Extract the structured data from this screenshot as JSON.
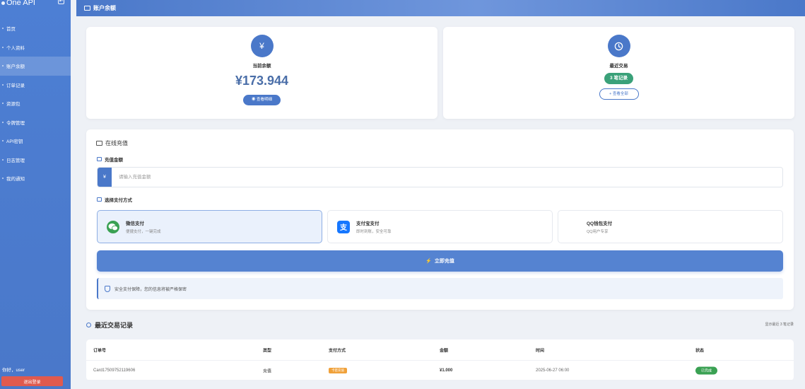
{
  "brand": {
    "name": "One API"
  },
  "sidebar": {
    "items": [
      {
        "label": "首页",
        "active": false
      },
      {
        "label": "个人资料",
        "active": false
      },
      {
        "label": "账户余额",
        "active": true
      },
      {
        "label": "订单记录",
        "active": false
      },
      {
        "label": "资源包",
        "active": false
      },
      {
        "label": "令牌管理",
        "active": false
      },
      {
        "label": "API密钥",
        "active": false
      },
      {
        "label": "日志管理",
        "active": false
      },
      {
        "label": "我的通知",
        "active": false
      }
    ],
    "greeting": "你好，user",
    "logout_label": "退出登录"
  },
  "header": {
    "title": "账户余额"
  },
  "balance": {
    "label": "当前余额",
    "value": "¥173.944",
    "button": "查看明细"
  },
  "recent": {
    "label": "最近交易",
    "count_badge": "3 笔记录",
    "button": "+ 查看全部"
  },
  "recharge": {
    "title": "在线充值",
    "amount_label": "充值金额",
    "currency_prefix": "¥",
    "amount_placeholder": "请输入充值金额",
    "method_label": "选择支付方式",
    "methods": [
      {
        "name": "微信支付",
        "desc": "便捷支付，一键完成",
        "selected": true,
        "icon": "wechat-icon"
      },
      {
        "name": "支付宝支付",
        "desc": "即时到账，安全可靠",
        "selected": false,
        "icon": "alipay-icon"
      },
      {
        "name": "QQ钱包支付",
        "desc": "QQ用户专享",
        "selected": false,
        "icon": "qq-icon"
      }
    ],
    "submit": "立即充值",
    "secure_note": "安全支付保障，您的信息将被严格保密"
  },
  "transactions": {
    "title": "最近交易记录",
    "summary": "显示最近 3 笔记录",
    "columns": [
      "订单号",
      "类型",
      "支付方式",
      "金额",
      "时间",
      "状态"
    ],
    "rows": [
      {
        "order": "Card17509752119606",
        "type": "充值",
        "method": "卡密充值",
        "amount": "¥1.000",
        "time": "2025-06-27 06:00",
        "status": "已完成"
      }
    ]
  },
  "colors": {
    "primary": "#4a78c9",
    "success": "#3aa153",
    "danger": "#e05a4e"
  }
}
